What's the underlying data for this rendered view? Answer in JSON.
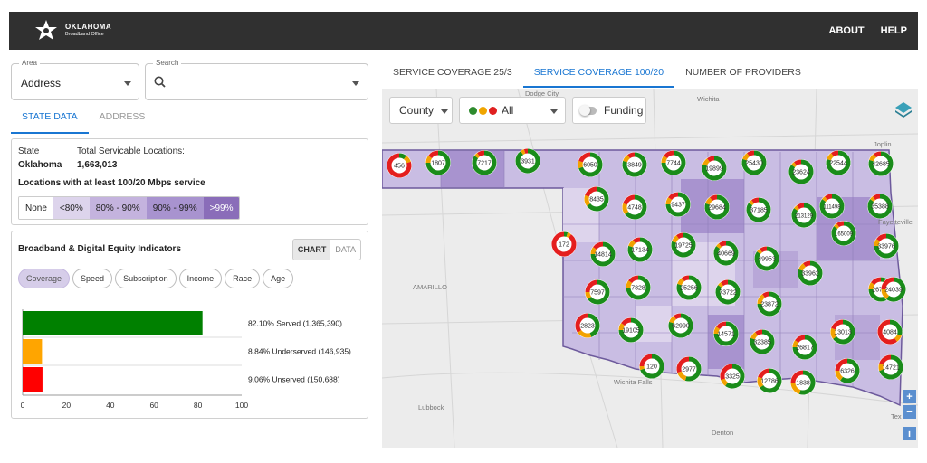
{
  "header": {
    "logo_title": "OKLAHOMA",
    "logo_subtitle": "Broadband Office",
    "nav": [
      "ABOUT",
      "HELP"
    ]
  },
  "area": {
    "label": "Area",
    "value": "Address"
  },
  "search": {
    "label": "Search",
    "placeholder": ""
  },
  "left_tabs": [
    "STATE DATA",
    "ADDRESS"
  ],
  "state_data": {
    "state_label": "State",
    "state_value": "Oklahoma",
    "total_label": "Total Servicable Locations:",
    "total_value": "1,663,013",
    "locations_title": "Locations with at least 100/20 Mbps service",
    "legend": [
      "None",
      "<80%",
      "80% - 90%",
      "90% - 99%",
      ">99%"
    ]
  },
  "indicators": {
    "title": "Broadband & Digital Equity Indicators",
    "view_toggle": [
      "CHART",
      "DATA"
    ],
    "chips": [
      "Coverage",
      "Speed",
      "Subscription",
      "Income",
      "Race",
      "Age"
    ]
  },
  "chart_data": {
    "type": "bar",
    "orientation": "horizontal",
    "categories": [
      "Served",
      "Underserved",
      "Unserved"
    ],
    "values": [
      82.1,
      8.84,
      9.06
    ],
    "labels": [
      "82.10% Served (1,365,390)",
      "8.84% Underserved (146,935)",
      "9.06% Unserved (150,688)"
    ],
    "colors": [
      "#008000",
      "#ffa500",
      "#ff0000"
    ],
    "xlim": [
      0,
      100
    ],
    "xticks": [
      0,
      20,
      40,
      60,
      80,
      100
    ]
  },
  "right_tabs": [
    "SERVICE COVERAGE 25/3",
    "SERVICE COVERAGE 100/20",
    "NUMBER OF PROVIDERS"
  ],
  "map_controls": {
    "level": "County",
    "filter": "All",
    "funding": "Funding",
    "info": "i"
  },
  "map_labels": [
    "Dodge City",
    "Wichita",
    "Joplin",
    "Fayetteville",
    "AMARILLO",
    "Wichita Falls",
    "Lubbock",
    "Denton",
    "Tex"
  ],
  "markers": [
    {
      "label": "456",
      "g": 0.1,
      "o": 0.1
    },
    {
      "label": "1807",
      "g": 0.75,
      "o": 0.1
    },
    {
      "label": "7217",
      "g": 0.85,
      "o": 0.05
    },
    {
      "label": "3931",
      "g": 0.9,
      "o": 0.05
    },
    {
      "label": "6050",
      "g": 0.7,
      "o": 0.1
    },
    {
      "label": "3849",
      "g": 0.8,
      "o": 0.1
    },
    {
      "label": "7744",
      "g": 0.75,
      "o": 0.1
    },
    {
      "label": "19899",
      "g": 0.8,
      "o": 0.1
    },
    {
      "label": "25430",
      "g": 0.8,
      "o": 0.1
    },
    {
      "label": "23624",
      "g": 0.85,
      "o": 0.05
    },
    {
      "label": "22544",
      "g": 0.8,
      "o": 0.1
    },
    {
      "label": "42685",
      "g": 0.8,
      "o": 0.1
    },
    {
      "label": "8435",
      "g": 0.65,
      "o": 0.15
    },
    {
      "label": "4748",
      "g": 0.65,
      "o": 0.15
    },
    {
      "label": "9437",
      "g": 0.75,
      "o": 0.1
    },
    {
      "label": "29684",
      "g": 0.8,
      "o": 0.1
    },
    {
      "label": "37185",
      "g": 0.85,
      "o": 0.05
    },
    {
      "label": "213129",
      "g": 0.85,
      "o": 0.05
    },
    {
      "label": "111498",
      "g": 0.85,
      "o": 0.05
    },
    {
      "label": "35388",
      "g": 0.85,
      "o": 0.05
    },
    {
      "label": "165009",
      "g": 0.85,
      "o": 0.05
    },
    {
      "label": "172",
      "g": 0.05,
      "o": 0.05
    },
    {
      "label": "14814",
      "g": 0.75,
      "o": 0.1
    },
    {
      "label": "17134",
      "g": 0.8,
      "o": 0.1
    },
    {
      "label": "19725",
      "g": 0.8,
      "o": 0.1
    },
    {
      "label": "40669",
      "g": 0.85,
      "o": 0.05
    },
    {
      "label": "49953",
      "g": 0.85,
      "o": 0.05
    },
    {
      "label": "33976",
      "g": 0.75,
      "o": 0.1
    },
    {
      "label": "33962",
      "g": 0.8,
      "o": 0.1
    },
    {
      "label": "7597",
      "g": 0.65,
      "o": 0.1
    },
    {
      "label": "7828",
      "g": 0.75,
      "o": 0.1
    },
    {
      "label": "25256",
      "g": 0.8,
      "o": 0.1
    },
    {
      "label": "73722",
      "g": 0.85,
      "o": 0.05
    },
    {
      "label": "26782",
      "g": 0.75,
      "o": 0.1
    },
    {
      "label": "24039",
      "g": 0.6,
      "o": 0.15
    },
    {
      "label": "23872",
      "g": 0.75,
      "o": 0.15
    },
    {
      "label": "2823",
      "g": 0.45,
      "o": 0.2
    },
    {
      "label": "19105",
      "g": 0.75,
      "o": 0.1
    },
    {
      "label": "62990",
      "g": 0.8,
      "o": 0.1
    },
    {
      "label": "14571",
      "g": 0.75,
      "o": 0.1
    },
    {
      "label": "32385",
      "g": 0.8,
      "o": 0.1
    },
    {
      "label": "13013",
      "g": 0.65,
      "o": 0.15
    },
    {
      "label": "4084",
      "g": 0.3,
      "o": 0.1
    },
    {
      "label": "26817",
      "g": 0.75,
      "o": 0.1
    },
    {
      "label": "120",
      "g": 0.7,
      "o": 0.05
    },
    {
      "label": "2977",
      "g": 0.55,
      "o": 0.15
    },
    {
      "label": "3325",
      "g": 0.6,
      "o": 0.1
    },
    {
      "label": "12786",
      "g": 0.65,
      "o": 0.15
    },
    {
      "label": "1838",
      "g": 0.55,
      "o": 0.2
    },
    {
      "label": "6326",
      "g": 0.6,
      "o": 0.15
    },
    {
      "label": "14721",
      "g": 0.7,
      "o": 0.1
    }
  ]
}
